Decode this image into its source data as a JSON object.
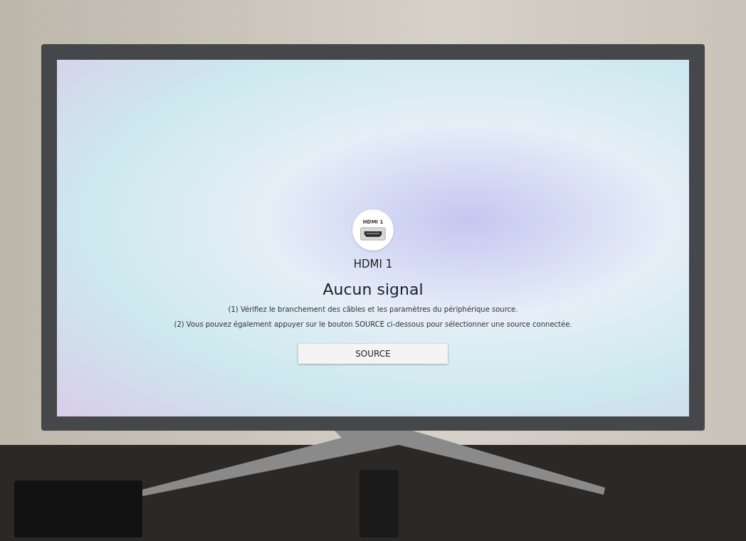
{
  "input": {
    "icon_label": "HDMI 1",
    "name": "HDMI 1"
  },
  "message": {
    "title": "Aucun signal",
    "lines": [
      "(1) Vérifiez le branchement des câbles et les paramètres du périphérique source.",
      "(2) Vous pouvez également appuyer sur le bouton SOURCE ci-dessous pour sélectionner une source connectée."
    ]
  },
  "buttons": [
    {
      "label": "SOURCE",
      "selected": false
    }
  ]
}
